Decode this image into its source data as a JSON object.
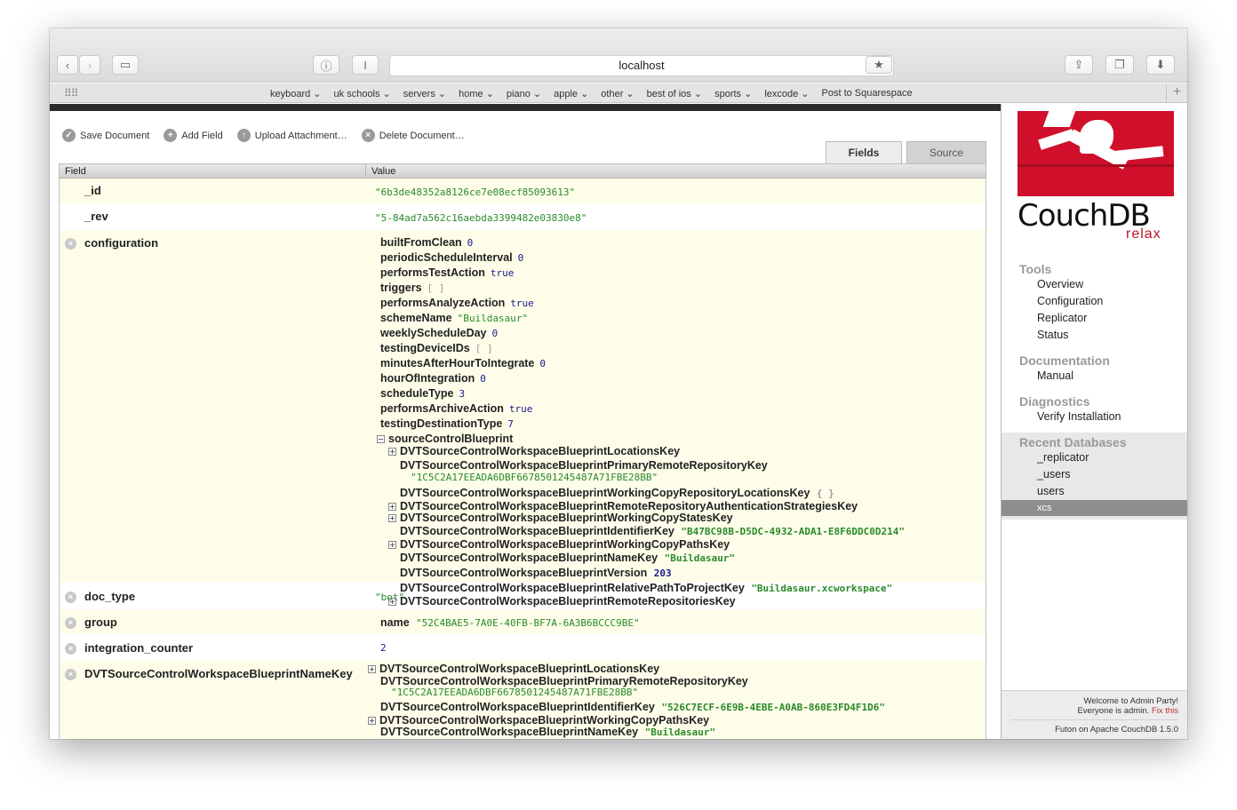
{
  "browser": {
    "url": "localhost",
    "bookmarks": [
      "keyboard ⌄",
      "uk schools ⌄",
      "servers ⌄",
      "home ⌄",
      "piano ⌄",
      "apple ⌄",
      "other ⌄",
      "best of ios ⌄",
      "sports ⌄",
      "lexcode ⌄",
      "Post to Squarespace"
    ]
  },
  "actions": {
    "save": "Save Document",
    "add": "Add Field",
    "upload": "Upload Attachment…",
    "delete": "Delete Document…"
  },
  "tabs": {
    "fields": "Fields",
    "source": "Source"
  },
  "table": {
    "field_header": "Field",
    "value_header": "Value",
    "id": {
      "name": "_id",
      "value": "\"6b3de48352a8126ce7e08ecf85093613\""
    },
    "rev": {
      "name": "_rev",
      "value": "\"5-84ad7a562c16aebda3399482e03830e8\""
    },
    "configuration": {
      "name": "configuration",
      "items": [
        {
          "k": "builtFromClean",
          "v": "0",
          "t": "num"
        },
        {
          "k": "periodicScheduleInterval",
          "v": "0",
          "t": "num"
        },
        {
          "k": "performsTestAction",
          "v": "true",
          "t": "num"
        },
        {
          "k": "triggers",
          "v": "[ ]",
          "t": "arr"
        },
        {
          "k": "performsAnalyzeAction",
          "v": "true",
          "t": "num"
        },
        {
          "k": "schemeName",
          "v": "\"Buildasaur\"",
          "t": "str"
        },
        {
          "k": "weeklyScheduleDay",
          "v": "0",
          "t": "num"
        },
        {
          "k": "testingDeviceIDs",
          "v": "[ ]",
          "t": "arr"
        },
        {
          "k": "minutesAfterHourToIntegrate",
          "v": "0",
          "t": "num"
        },
        {
          "k": "hourOfIntegration",
          "v": "0",
          "t": "num"
        },
        {
          "k": "scheduleType",
          "v": "3",
          "t": "num"
        },
        {
          "k": "performsArchiveAction",
          "v": "true",
          "t": "num"
        },
        {
          "k": "testingDestinationType",
          "v": "7",
          "t": "num"
        }
      ],
      "scb_key": "sourceControlBlueprint",
      "scb": {
        "locations": "DVTSourceControlWorkspaceBlueprintLocationsKey",
        "primary": "DVTSourceControlWorkspaceBlueprintPrimaryRemoteRepositoryKey",
        "primary_val": "\"1C5C2A17EEADA6DBF6678501245487A71FBE28BB\"",
        "wc_locations": "DVTSourceControlWorkspaceBlueprintWorkingCopyRepositoryLocationsKey",
        "wc_locations_val": "{ }",
        "auth": "DVTSourceControlWorkspaceBlueprintRemoteRepositoryAuthenticationStrategiesKey",
        "states": "DVTSourceControlWorkspaceBlueprintWorkingCopyStatesKey",
        "identifier": "DVTSourceControlWorkspaceBlueprintIdentifierKey",
        "identifier_val": "\"B47BC98B-D5DC-4932-ADA1-E8F6DDC0D214\"",
        "paths": "DVTSourceControlWorkspaceBlueprintWorkingCopyPathsKey",
        "name": "DVTSourceControlWorkspaceBlueprintNameKey",
        "name_val": "\"Buildasaur\"",
        "version": "DVTSourceControlWorkspaceBlueprintVersion",
        "version_val": "203",
        "relpath": "DVTSourceControlWorkspaceBlueprintRelativePathToProjectKey",
        "relpath_val": "\"Buildasaur.xcworkspace\"",
        "remotes": "DVTSourceControlWorkspaceBlueprintRemoteRepositoriesKey"
      }
    },
    "doc_type": {
      "name": "doc_type",
      "value": "\"bot\""
    },
    "group": {
      "name": "group",
      "key": "name",
      "value": "\"52C4BAE5-7A0E-40FB-BF7A-6A3B6BCCC9BE\""
    },
    "integration_counter": {
      "name": "integration_counter",
      "value": "2"
    },
    "lrb": {
      "name": "DVTSourceControlWorkspaceBlueprintNameKey",
      "locations": "DVTSourceControlWorkspaceBlueprintLocationsKey",
      "primary": "DVTSourceControlWorkspaceBlueprintPrimaryRemoteRepositoryKey",
      "primary_val": "\"1C5C2A17EEADA6DBF6678501245487A71FBE28BB\"",
      "identifier": "DVTSourceControlWorkspaceBlueprintIdentifierKey",
      "identifier_val": "\"526C7ECF-6E9B-4EBE-A0AB-860E3FD4F1D6\"",
      "paths": "DVTSourceControlWorkspaceBlueprintWorkingCopyPathsKey",
      "name_val": "\"Buildasaur\""
    }
  },
  "sidebar": {
    "logo": "CouchDB",
    "logo_tag": "relax",
    "tools": "Tools",
    "tools_items": [
      "Overview",
      "Configuration",
      "Replicator",
      "Status"
    ],
    "docs": "Documentation",
    "docs_items": [
      "Manual"
    ],
    "diag": "Diagnostics",
    "diag_items": [
      "Verify Installation"
    ],
    "recent": "Recent Databases",
    "recent_items": [
      "_replicator",
      "_users",
      "users",
      "xcs"
    ],
    "welcome": "Welcome to Admin Party!",
    "admin": "Everyone is admin.",
    "fix": "Fix this",
    "version": "Futon on Apache CouchDB 1.5.0"
  }
}
